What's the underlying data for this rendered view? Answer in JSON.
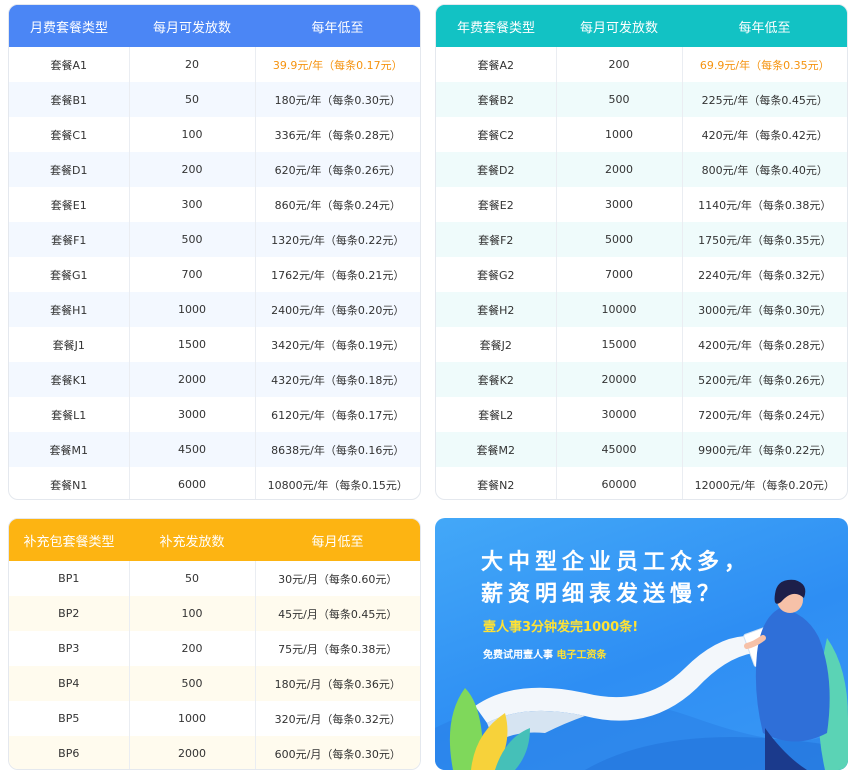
{
  "monthly": {
    "headers": [
      "月费套餐类型",
      "每月可发放数",
      "每年低至"
    ],
    "rows": [
      [
        "套餐A1",
        "20",
        "39.9元/年（每条0.17元）"
      ],
      [
        "套餐B1",
        "50",
        "180元/年（每条0.30元）"
      ],
      [
        "套餐C1",
        "100",
        "336元/年（每条0.28元）"
      ],
      [
        "套餐D1",
        "200",
        "620元/年（每条0.26元）"
      ],
      [
        "套餐E1",
        "300",
        "860元/年（每条0.24元）"
      ],
      [
        "套餐F1",
        "500",
        "1320元/年（每条0.22元）"
      ],
      [
        "套餐G1",
        "700",
        "1762元/年（每条0.21元）"
      ],
      [
        "套餐H1",
        "1000",
        "2400元/年（每条0.20元）"
      ],
      [
        "套餐J1",
        "1500",
        "3420元/年（每条0.19元）"
      ],
      [
        "套餐K1",
        "2000",
        "4320元/年（每条0.18元）"
      ],
      [
        "套餐L1",
        "3000",
        "6120元/年（每条0.17元）"
      ],
      [
        "套餐M1",
        "4500",
        "8638元/年（每条0.16元）"
      ],
      [
        "套餐N1",
        "6000",
        "10800元/年（每条0.15元）"
      ]
    ]
  },
  "yearly": {
    "headers": [
      "年费套餐类型",
      "每月可发放数",
      "每年低至"
    ],
    "rows": [
      [
        "套餐A2",
        "200",
        "69.9元/年（每条0.35元）"
      ],
      [
        "套餐B2",
        "500",
        "225元/年（每条0.45元）"
      ],
      [
        "套餐C2",
        "1000",
        "420元/年（每条0.42元）"
      ],
      [
        "套餐D2",
        "2000",
        "800元/年（每条0.40元）"
      ],
      [
        "套餐E2",
        "3000",
        "1140元/年（每条0.38元）"
      ],
      [
        "套餐F2",
        "5000",
        "1750元/年（每条0.35元）"
      ],
      [
        "套餐G2",
        "7000",
        "2240元/年（每条0.32元）"
      ],
      [
        "套餐H2",
        "10000",
        "3000元/年（每条0.30元）"
      ],
      [
        "套餐J2",
        "15000",
        "4200元/年（每条0.28元）"
      ],
      [
        "套餐K2",
        "20000",
        "5200元/年（每条0.26元）"
      ],
      [
        "套餐L2",
        "30000",
        "7200元/年（每条0.24元）"
      ],
      [
        "套餐M2",
        "45000",
        "9900元/年（每条0.22元）"
      ],
      [
        "套餐N2",
        "60000",
        "12000元/年（每条0.20元）"
      ]
    ]
  },
  "supplement": {
    "headers": [
      "补充包套餐类型",
      "补充发放数",
      "每月低至"
    ],
    "rows": [
      [
        "BP1",
        "50",
        "30元/月（每条0.60元）"
      ],
      [
        "BP2",
        "100",
        "45元/月（每条0.45元）"
      ],
      [
        "BP3",
        "200",
        "75元/月（每条0.38元）"
      ],
      [
        "BP4",
        "500",
        "180元/月（每条0.36元）"
      ],
      [
        "BP5",
        "1000",
        "320元/月（每条0.32元）"
      ],
      [
        "BP6",
        "2000",
        "600元/月（每条0.30元）"
      ]
    ]
  },
  "banner": {
    "line1": "大中型企业员工众多，",
    "line2": "薪资明细表发送慢？",
    "subtitle": "壹人事3分钟发完1000条!",
    "note_prefix": "免费试用壹人事",
    "note_highlight": "电子工资条",
    "paper_label": "电子工资条"
  },
  "colors": {
    "monthly_header": "#4b86f5",
    "yearly_header": "#12c2c4",
    "supplement_header": "#fdb412",
    "highlight_price": "#f5930f",
    "banner_bg": "#2e8ef3",
    "banner_yellow": "#ffe234"
  }
}
